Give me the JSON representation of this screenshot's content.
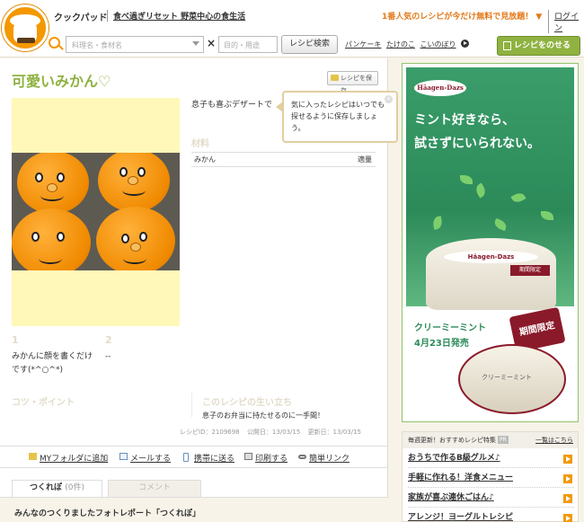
{
  "header": {
    "brand": "クックパッド",
    "tagline": "食べ過ぎリセット 野菜中心の食生活",
    "promo": "1番人気のレシピが今だけ無料で見放題！ ▼",
    "login": "ログイン",
    "search": {
      "keyword_placeholder": "料理名・食材名",
      "purpose_placeholder": "目的・用途",
      "button": "レシピ検索",
      "times": "×"
    },
    "keyword_links": [
      "パンケーキ",
      "たけのこ",
      "こいのぼり"
    ],
    "post_button": "レシピをのせる"
  },
  "recipe": {
    "title": "可愛いみかん♡",
    "save_button": "レシピを保存",
    "tooltip": "気に入ったレシピはいつでも探せるように保存しましょう。",
    "description": "息子も喜ぶデザートで",
    "ingredients_heading": "材料",
    "ingredients": [
      {
        "name": "みかん",
        "amount": "適量"
      }
    ],
    "steps": [
      {
        "num": "1",
        "text": "みかんに顔を書くだけです(*^○^*)"
      },
      {
        "num": "2",
        "text": "--"
      }
    ],
    "tips_heading": "コツ・ポイント",
    "story_heading": "このレシピの生い立ち",
    "story_text": "息子のお弁当に持たせるのに一手間！",
    "meta": {
      "recipe_id": "レシピID：2109698",
      "published": "公開日：13/03/15",
      "updated": "更新日：13/03/15"
    }
  },
  "actions": [
    {
      "label": "MYフォルダに追加",
      "icon": "folder-icon"
    },
    {
      "label": "メールする",
      "icon": "mail-icon"
    },
    {
      "label": "携帯に送る",
      "icon": "phone-icon"
    },
    {
      "label": "印刷する",
      "icon": "print-icon"
    },
    {
      "label": "簡単リンク",
      "icon": "link-icon"
    }
  ],
  "tabs": {
    "tsukurepo": "つくれぽ",
    "tsukurepo_count": "(0件)",
    "comment": "コメント"
  },
  "report_heading": "みんなのつくりましたフォトレポート「つくれぽ」",
  "ad": {
    "logo": "Häagen-Dazs",
    "copy_line1": "ミント好きなら、",
    "copy_line2": "試さずにいられない。",
    "cup_label": "Häagen-Dazs",
    "cup_limited": "期間限定",
    "product_line1": "クリーミーミント",
    "product_line2": "4月23日発売",
    "badge": "期間限定",
    "mini_cup_text": "クリーミーミント"
  },
  "osusume": {
    "heading": "毎週更新！おすすめレシピ特集",
    "pr": "PR",
    "all_link": "一覧はこちら",
    "items": [
      "おうちで作るB級グルメ♪",
      "手軽に作れる！洋食メニュー",
      "家族が喜ぶ連休ごはん♪",
      "アレンジ！ヨーグルトレシピ"
    ]
  },
  "colors": {
    "accent_orange": "#f39800",
    "title_green": "#8fb241",
    "heading_beige": "#e3dccb",
    "ad_green": "#2c8a59"
  }
}
